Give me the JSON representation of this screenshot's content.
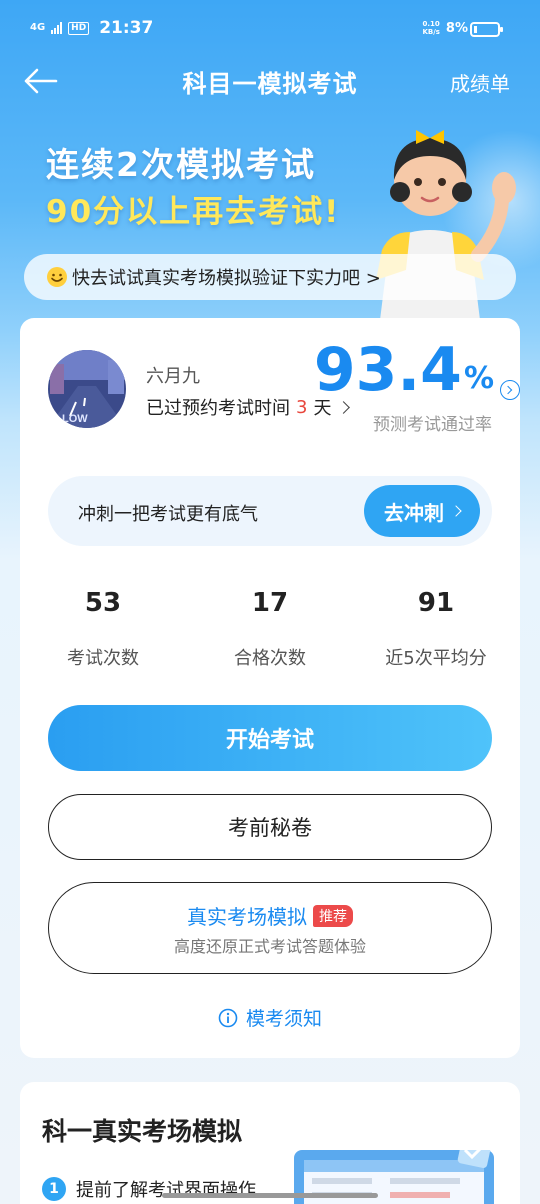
{
  "status_bar": {
    "network": "4G",
    "hd": "HD",
    "time": "21:37",
    "speed_value": "0.10",
    "speed_unit": "KB/s",
    "battery": "8%"
  },
  "nav": {
    "title": "科目一模拟考试",
    "right_link": "成绩单"
  },
  "hero": {
    "line1": "连续2次模拟考试",
    "line2": "90分以上再去考试!",
    "banner": "快去试试真实考场模拟验证下实力吧 >"
  },
  "profile": {
    "name": "六月九",
    "exam_prefix": "已过预约考试时间",
    "exam_days": "3",
    "exam_suffix": "天",
    "pass_rate": "93.4",
    "pass_rate_unit": "%",
    "pass_rate_label": "预测考试通过率"
  },
  "sprint": {
    "text": "冲刺一把考试更有底气",
    "button": "去冲刺"
  },
  "stats": [
    {
      "value": "53",
      "label": "考试次数"
    },
    {
      "value": "17",
      "label": "合格次数"
    },
    {
      "value": "91",
      "label": "近5次平均分"
    }
  ],
  "buttons": {
    "start": "开始考试",
    "secret": "考前秘卷",
    "real_title": "真实考场模拟",
    "real_badge": "推荐",
    "real_sub": "高度还原正式考试答题体验",
    "notice": "模考须知"
  },
  "section2": {
    "title": "科一真实考场模拟",
    "step_num": "1",
    "step_text": "提前了解考试界面操作"
  },
  "colors": {
    "accent": "#1a8af0",
    "primary_button": "#2fa5f3",
    "warning": "#e8473d",
    "hero_yellow": "#ffe85a"
  }
}
